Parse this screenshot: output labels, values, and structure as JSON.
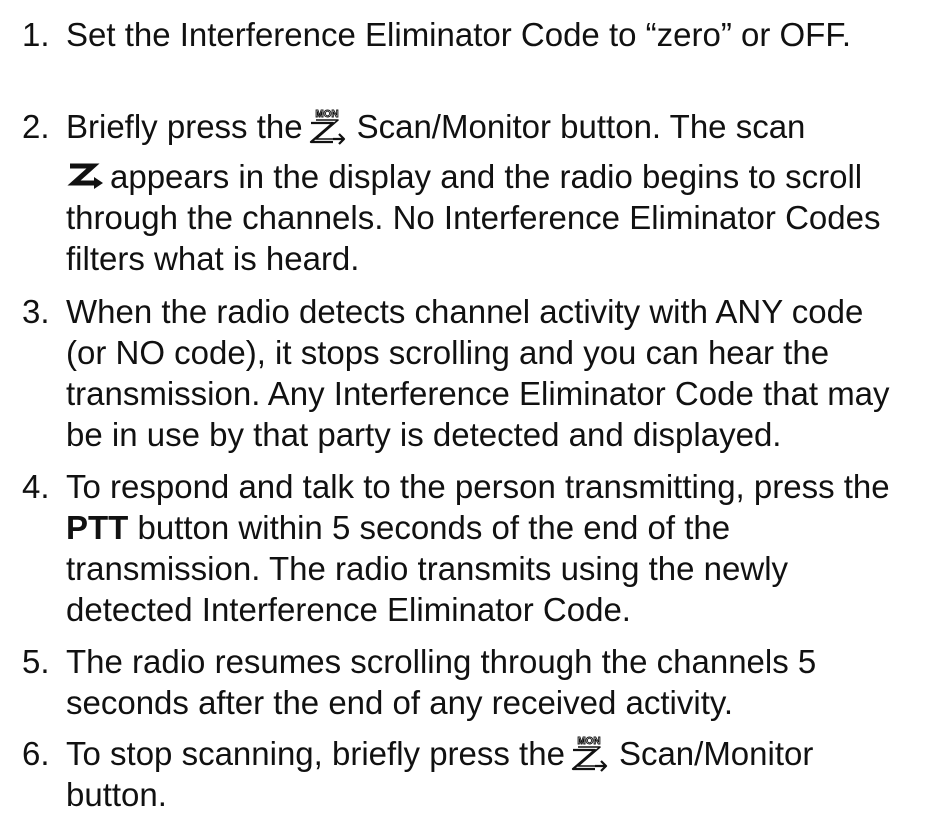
{
  "steps": [
    {
      "number": "1.",
      "lines": [
        "Set the Interference Eliminator Code to “zero” or OFF."
      ]
    },
    {
      "number": "2.",
      "l1_before": "Briefly press the",
      "l1_after": "Scan/Monitor button. The scan",
      "l2_after": "appears in the display and the radio begins to scroll",
      "l3": "through the channels. No Interference Eliminator Codes",
      "l4": "filters what is heard."
    },
    {
      "number": "3.",
      "lines": [
        "When the radio detects channel activity with ANY code",
        "(or NO code), it stops scrolling and you can hear the",
        "transmission. Any Interference Eliminator Code that may",
        "be in use by that party is detected and displayed."
      ]
    },
    {
      "number": "4.",
      "l1": "To respond and talk to the person transmitting, press the",
      "l2_bold": "PTT",
      "l2_rest": " button within 5 seconds of the end of the",
      "l3": "transmission. The radio transmits using the newly",
      "l4": "detected Interference Eliminator Code."
    },
    {
      "number": "5.",
      "lines": [
        "The radio resumes scrolling through the channels 5",
        "seconds after the end of any received activity."
      ]
    },
    {
      "number": "6.",
      "l1_before": "To stop scanning, briefly press the",
      "l1_after": "Scan/Monitor",
      "l2": "button."
    }
  ],
  "icons": {
    "mon_label": "MON",
    "scan_monitor_button": "scan-monitor-button-icon",
    "scan_indicator": "scan-indicator-icon"
  }
}
